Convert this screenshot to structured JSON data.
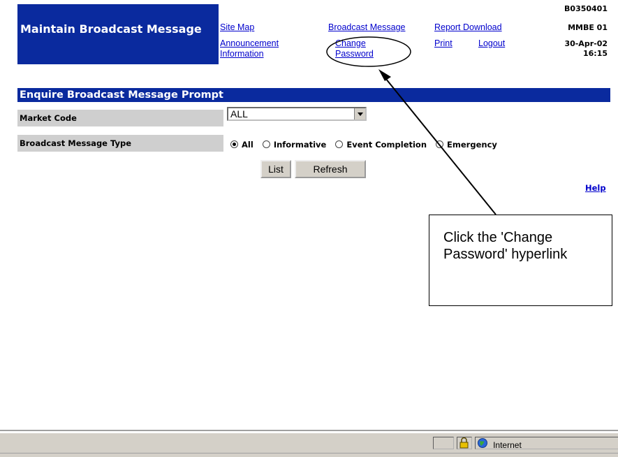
{
  "header": {
    "title": "Maintain Broadcast Message",
    "links": {
      "site_map": "Site Map",
      "announcement": "Announcement Information",
      "broadcast_message": "Broadcast Message",
      "report_download": "Report Download",
      "change_password": "Change Password",
      "print": "Print",
      "logout": "Logout"
    },
    "meta": {
      "screen_id": "B0350401",
      "user": "MMBE 01",
      "date": "30-Apr-02",
      "time": "16:15"
    }
  },
  "section": {
    "title": "Enquire Broadcast Message Prompt"
  },
  "form": {
    "market_code_label": "Market Code",
    "market_code_value": "ALL",
    "message_type_label": "Broadcast Message Type",
    "message_type_options": [
      "All",
      "Informative",
      "Event Completion",
      "Emergency"
    ],
    "message_type_selected": "All",
    "list_button": "List",
    "refresh_button": "Refresh",
    "help_link": "Help"
  },
  "callout": {
    "text": "Click the 'Change Password' hyperlink"
  },
  "status_bar": {
    "zone": "Internet"
  },
  "colors": {
    "header_blue": "#0a2a9e",
    "label_gray": "#cfcfcf",
    "link_blue": "#0000cc"
  }
}
